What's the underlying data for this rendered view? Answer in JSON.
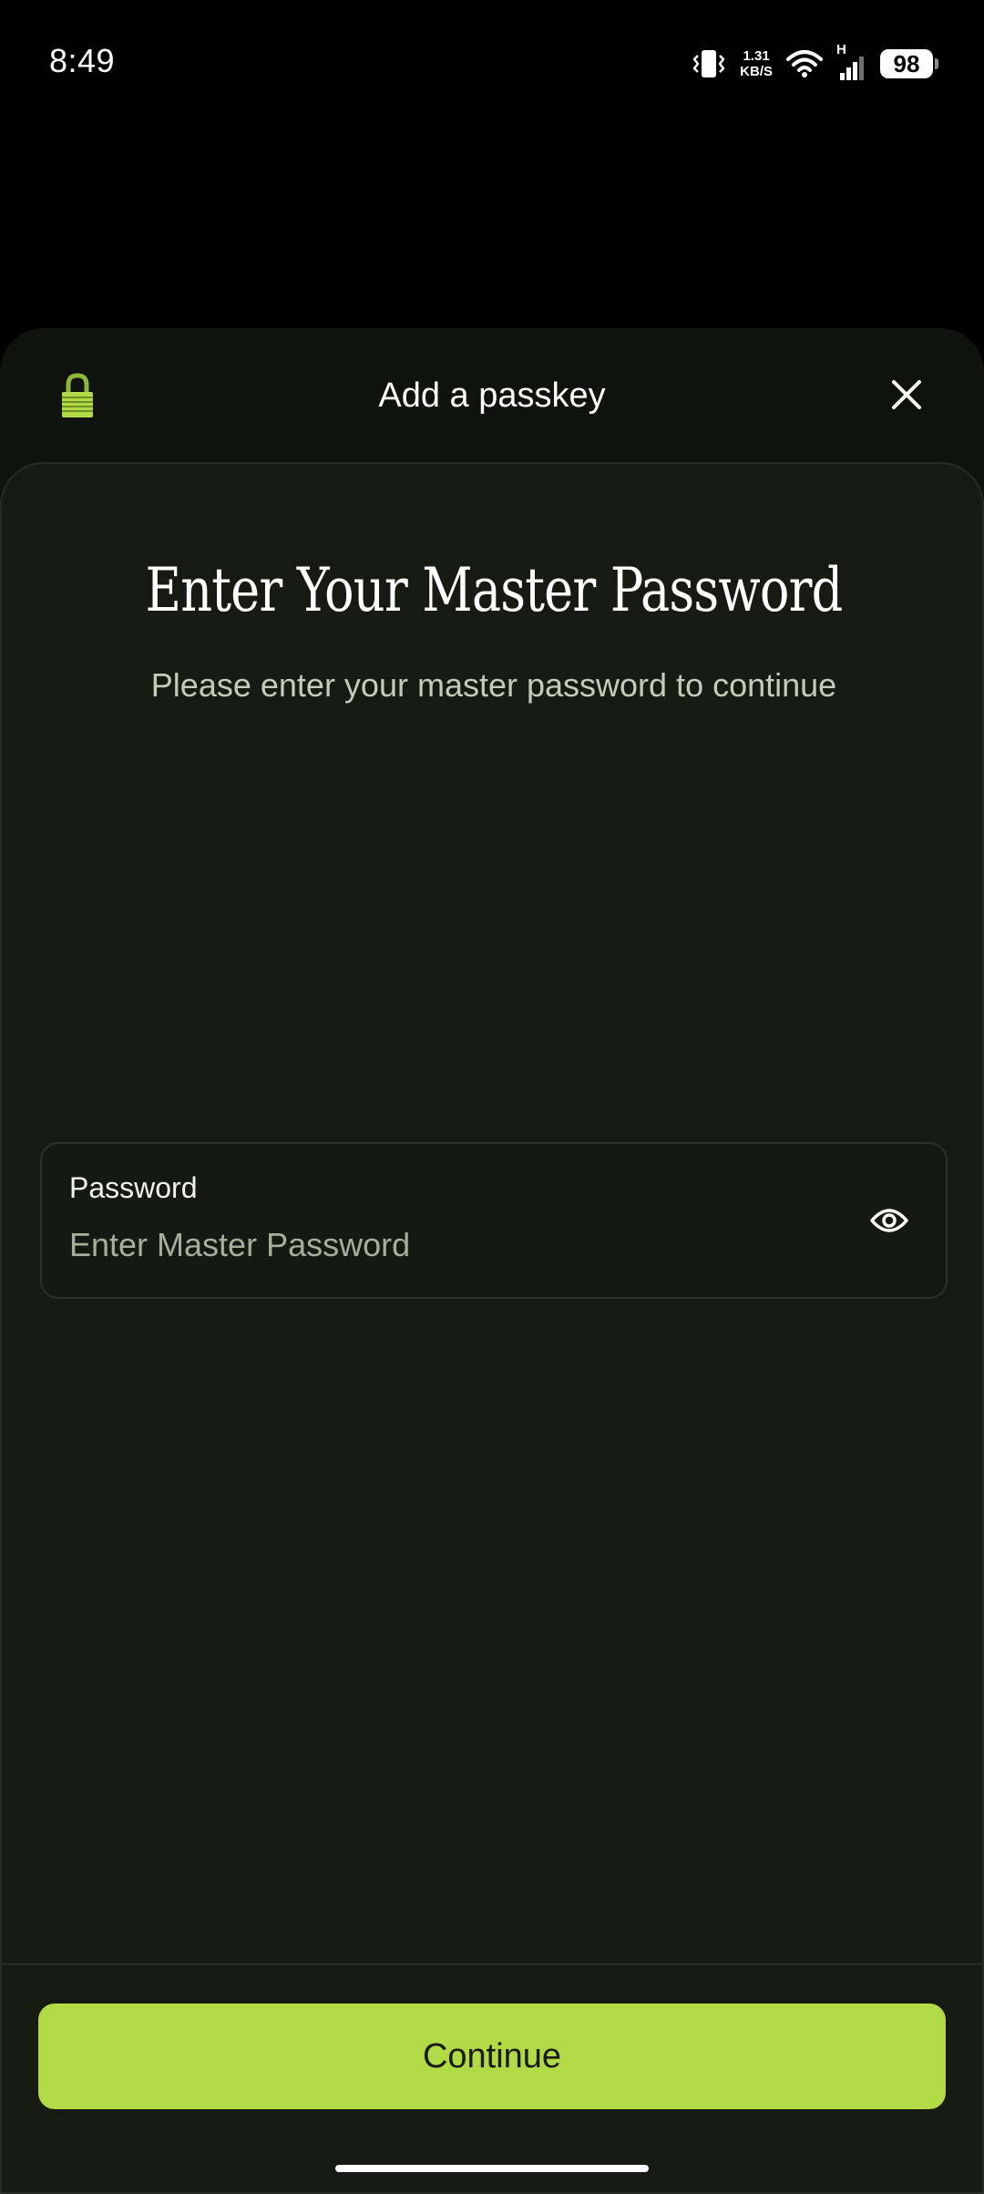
{
  "status_bar": {
    "time": "8:49",
    "net_speed_value": "1.31",
    "net_speed_unit": "KB/S",
    "network_type": "H",
    "battery_level": "98",
    "icons": [
      "vibrate-icon",
      "wifi-icon",
      "cell-signal-icon",
      "battery-icon"
    ]
  },
  "sheet": {
    "title": "Add a passkey",
    "lock_icon": "lock-icon",
    "close_icon": "close-icon"
  },
  "main": {
    "heading": "Enter Your Master Password",
    "subtitle": "Please enter your master password to continue",
    "password_field": {
      "label": "Password",
      "placeholder": "Enter Master Password",
      "value": "",
      "toggle_icon": "eye-icon"
    }
  },
  "footer": {
    "continue_label": "Continue"
  },
  "colors": {
    "accent": "#b2d946",
    "sheet_background": "#10120d",
    "card_background": "#171a13",
    "subtitle_text": "#c6cbb8",
    "placeholder_text": "#a9ae9b"
  }
}
